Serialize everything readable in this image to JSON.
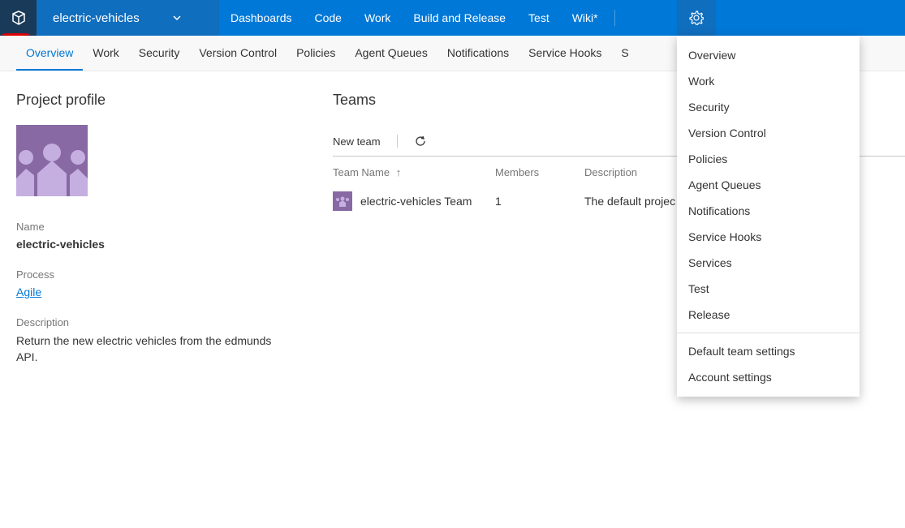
{
  "header": {
    "project": "electric-vehicles",
    "nav": [
      "Dashboards",
      "Code",
      "Work",
      "Build and Release",
      "Test",
      "Wiki*"
    ]
  },
  "subnav": [
    "Overview",
    "Work",
    "Security",
    "Version Control",
    "Policies",
    "Agent Queues",
    "Notifications",
    "Service Hooks",
    "S"
  ],
  "profile": {
    "title": "Project profile",
    "name_label": "Name",
    "name": "electric-vehicles",
    "process_label": "Process",
    "process": "Agile",
    "description_label": "Description",
    "description": "Return the new electric vehicles from the edmunds API."
  },
  "teams": {
    "title": "Teams",
    "new_team": "New team",
    "columns": {
      "name": "Team Name",
      "members": "Members",
      "description": "Description"
    },
    "rows": [
      {
        "name": "electric-vehicles Team",
        "members": "1",
        "description": "The default projec"
      }
    ]
  },
  "gear_menu": {
    "items": [
      "Overview",
      "Work",
      "Security",
      "Version Control",
      "Policies",
      "Agent Queues",
      "Notifications",
      "Service Hooks",
      "Services",
      "Test",
      "Release"
    ],
    "footer": [
      "Default team settings",
      "Account settings"
    ]
  }
}
